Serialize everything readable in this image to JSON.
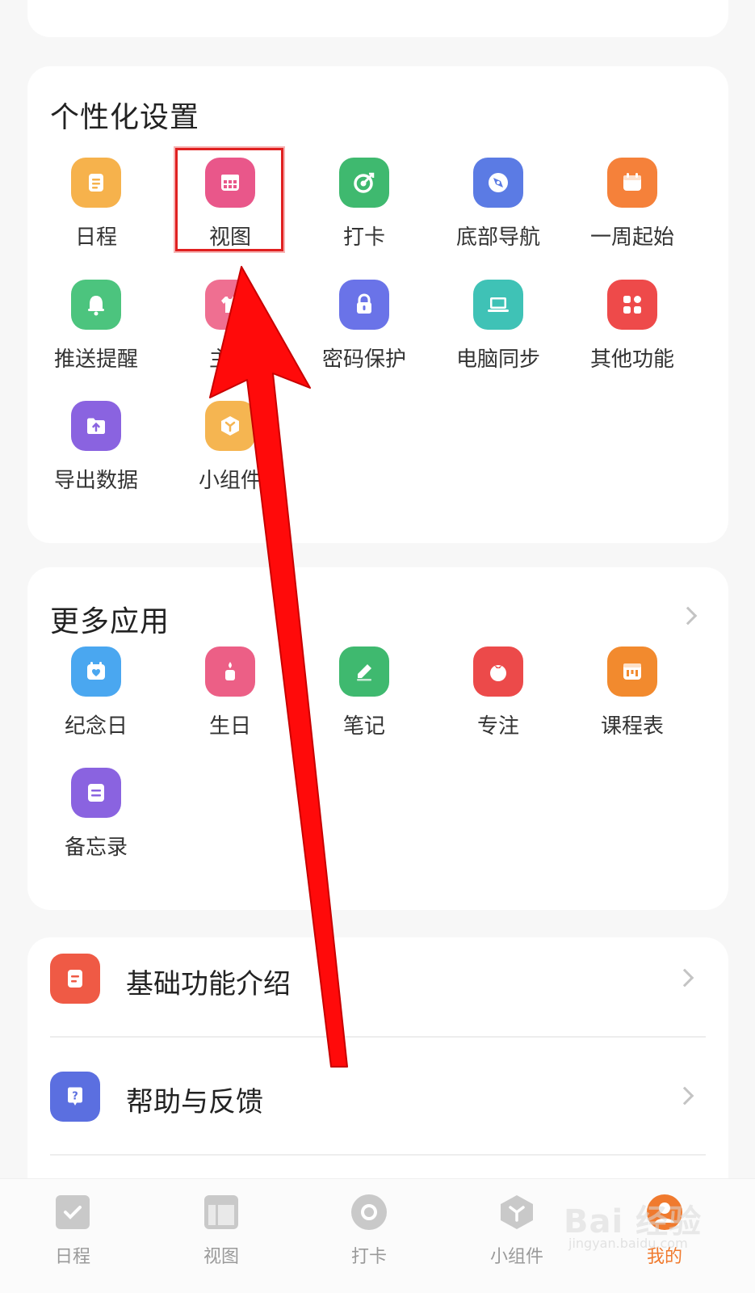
{
  "personal_settings": {
    "title": "个性化设置",
    "items": [
      {
        "label": "日程",
        "icon": "schedule-icon",
        "color": "#f6b24c"
      },
      {
        "label": "视图",
        "icon": "view-grid-icon",
        "color": "#e9578a"
      },
      {
        "label": "打卡",
        "icon": "check-in-target-icon",
        "color": "#3fb96f"
      },
      {
        "label": "底部导航",
        "icon": "compass-icon",
        "color": "#5b7be4"
      },
      {
        "label": "一周起始",
        "icon": "calendar-icon",
        "color": "#f5813a"
      },
      {
        "label": "推送提醒",
        "icon": "bell-icon",
        "color": "#4cc47e"
      },
      {
        "label": "主题",
        "icon": "shirt-icon",
        "color": "#ef6f91"
      },
      {
        "label": "密码保护",
        "icon": "lock-icon",
        "color": "#6a73e8"
      },
      {
        "label": "电脑同步",
        "icon": "laptop-icon",
        "color": "#3fc2b6"
      },
      {
        "label": "其他功能",
        "icon": "apps-icon",
        "color": "#ee4a4a"
      },
      {
        "label": "导出数据",
        "icon": "export-folder-icon",
        "color": "#8a63e0"
      },
      {
        "label": "小组件",
        "icon": "widget-cube-icon",
        "color": "#f5b551"
      }
    ]
  },
  "more_apps": {
    "title": "更多应用",
    "items": [
      {
        "label": "纪念日",
        "icon": "anniversary-icon",
        "color": "#4aa7f0"
      },
      {
        "label": "生日",
        "icon": "birthday-candle-icon",
        "color": "#ec5f86"
      },
      {
        "label": "笔记",
        "icon": "pencil-icon",
        "color": "#3fb96f"
      },
      {
        "label": "专注",
        "icon": "tomato-icon",
        "color": "#ec4a4a"
      },
      {
        "label": "课程表",
        "icon": "timetable-icon",
        "color": "#f28a2e"
      },
      {
        "label": "备忘录",
        "icon": "memo-icon",
        "color": "#8a63e0"
      }
    ]
  },
  "list": {
    "rows": [
      {
        "label": "基础功能介绍",
        "icon": "document-icon",
        "color": "#ef5a45"
      },
      {
        "label": "帮助与反馈",
        "icon": "help-question-icon",
        "color": "#5b6fe0"
      }
    ]
  },
  "tabbar": {
    "tabs": [
      {
        "label": "日程",
        "icon": "schedule-check-icon"
      },
      {
        "label": "视图",
        "icon": "view-layout-icon"
      },
      {
        "label": "打卡",
        "icon": "check-in-circle-icon"
      },
      {
        "label": "小组件",
        "icon": "widget-cube-icon"
      },
      {
        "label": "我的",
        "icon": "profile-icon",
        "active": true
      }
    ],
    "active_color": "#f07a2e"
  },
  "watermark": {
    "main": "Bai 经验",
    "sub": "jingyan.baidu.com"
  }
}
